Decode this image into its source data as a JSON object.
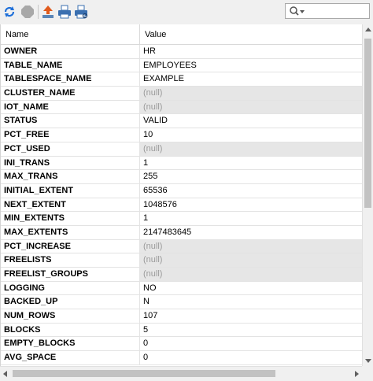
{
  "toolbar": {
    "icons": [
      "refresh-icon",
      "stop-icon",
      "export-icon",
      "print-icon",
      "print-preview-icon",
      "search-icon"
    ],
    "search_value": ""
  },
  "grid": {
    "columns": [
      "Name",
      "Value"
    ],
    "null_text": "(null)",
    "rows": [
      {
        "name": "OWNER",
        "value": "HR"
      },
      {
        "name": "TABLE_NAME",
        "value": "EMPLOYEES"
      },
      {
        "name": "TABLESPACE_NAME",
        "value": "EXAMPLE"
      },
      {
        "name": "CLUSTER_NAME",
        "value": "(null)"
      },
      {
        "name": "IOT_NAME",
        "value": "(null)"
      },
      {
        "name": "STATUS",
        "value": "VALID"
      },
      {
        "name": "PCT_FREE",
        "value": "10"
      },
      {
        "name": "PCT_USED",
        "value": "(null)"
      },
      {
        "name": "INI_TRANS",
        "value": "1"
      },
      {
        "name": "MAX_TRANS",
        "value": "255"
      },
      {
        "name": "INITIAL_EXTENT",
        "value": "65536"
      },
      {
        "name": "NEXT_EXTENT",
        "value": "1048576"
      },
      {
        "name": "MIN_EXTENTS",
        "value": "1"
      },
      {
        "name": "MAX_EXTENTS",
        "value": "2147483645"
      },
      {
        "name": "PCT_INCREASE",
        "value": "(null)"
      },
      {
        "name": "FREELISTS",
        "value": "(null)"
      },
      {
        "name": "FREELIST_GROUPS",
        "value": "(null)"
      },
      {
        "name": "LOGGING",
        "value": "NO"
      },
      {
        "name": "BACKED_UP",
        "value": "N"
      },
      {
        "name": "NUM_ROWS",
        "value": "107"
      },
      {
        "name": "BLOCKS",
        "value": "5"
      },
      {
        "name": "EMPTY_BLOCKS",
        "value": "0"
      },
      {
        "name": "AVG_SPACE",
        "value": "0"
      }
    ]
  },
  "colors": {
    "accent_blue": "#1e6fd9",
    "null_bg": "#e6e6e6",
    "null_text": "#9a9a9a"
  }
}
